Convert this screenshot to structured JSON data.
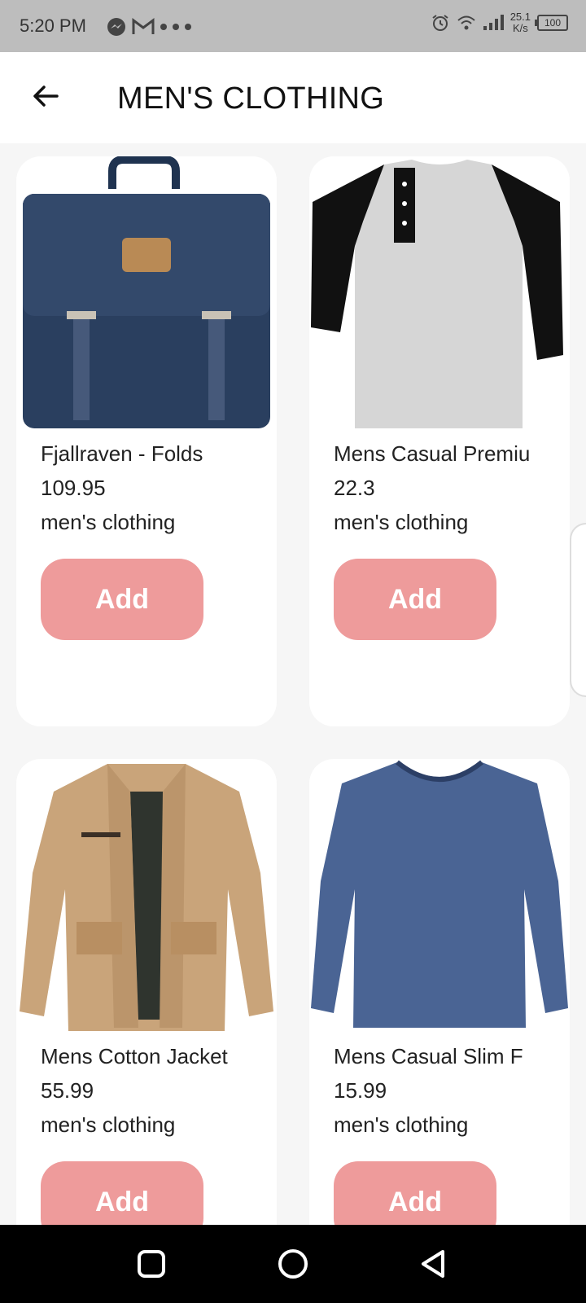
{
  "status_bar": {
    "time": "5:20 PM",
    "icons_left": [
      "messenger-icon",
      "gmail-icon",
      "more-dots-icon"
    ],
    "icons_right": [
      "alarm-icon",
      "wifi-icon",
      "signal-icon"
    ],
    "net_speed_value": "25.1",
    "net_speed_unit": "K/s",
    "battery": "100"
  },
  "app_bar": {
    "title": "MEN'S CLOTHING",
    "back_icon": "arrow-left-icon"
  },
  "products": [
    {
      "title": "Fjallraven - Folds",
      "price": "109.95",
      "category": "men's clothing",
      "button": "Add",
      "image": "backpack"
    },
    {
      "title": "Mens Casual Premiu",
      "price": "22.3",
      "category": "men's clothing",
      "button": "Add",
      "image": "raglan-henley-shirt"
    },
    {
      "title": "Mens Cotton Jacket",
      "price": "55.99",
      "category": "men's clothing",
      "button": "Add",
      "image": "cotton-jacket"
    },
    {
      "title": "Mens Casual Slim F",
      "price": "15.99",
      "category": "men's clothing",
      "button": "Add",
      "image": "long-sleeve-tshirt"
    }
  ],
  "colors": {
    "add_button": "#ee9b9b",
    "status_bar": "#bdbdbd",
    "background": "#f6f6f6"
  },
  "nav_bar": {
    "icons": [
      "recent-apps-icon",
      "home-icon",
      "back-triangle-icon"
    ]
  }
}
